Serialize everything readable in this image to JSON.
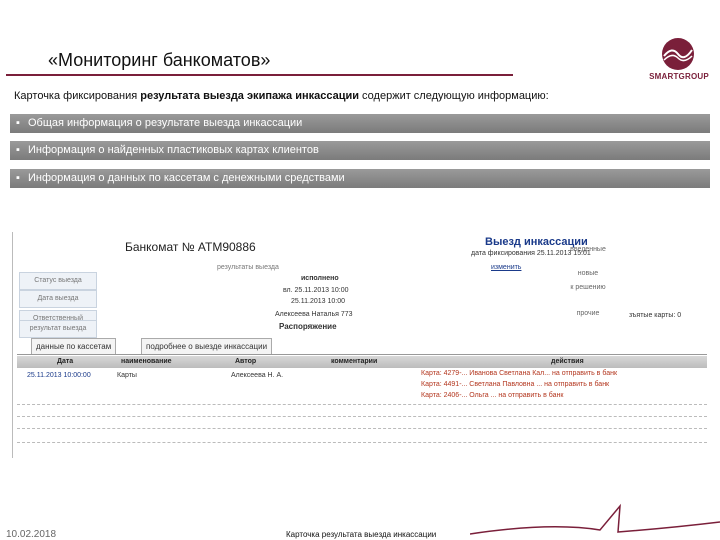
{
  "slide": {
    "title": "«Мониторинг банкоматов»",
    "intro_pre": "Карточка фиксирования ",
    "intro_bold": "результата выезда экипажа инкассации",
    "intro_post": " содержит следующую информацию:",
    "bars": [
      "Общая информация о результате выезда инкассации",
      "Информация о найденных пластиковых картах клиентов",
      "Информация о данных по кассетам с денежными средствами"
    ],
    "bullet": "▪",
    "logo_text": "SMARTGROUP",
    "footer_date": "10.02.2018",
    "footer_caption": "Карточка результата выезда инкассации",
    "accent_color": "#7a1f3a"
  },
  "screenshot": {
    "atm_title": "Банкомат № АТМ90886",
    "event_title": "Выезд инкассации",
    "event_date": "дата фиксирования 25.11.2013 15:01",
    "change_link": "изменить",
    "form": {
      "labels": [
        "Статус выезда",
        "Дата выезда",
        "Ответственный",
        "результат выезда"
      ],
      "status_header": "результаты выезда",
      "status_value": "исполнено",
      "date_value_1": "вл. 25.11.2013 10:00",
      "date_value_2": "25.11.2013 10:00",
      "responsible_value": "Алексеева Наталья 773",
      "result_value": "Распоряжение"
    },
    "right_labels": [
      "введенные",
      "новые",
      "к решению",
      "прочие"
    ],
    "right_tail": "зъятые карты: 0",
    "tabs": [
      "данные по кассетам",
      "подробнее о выезде инкассации"
    ],
    "table": {
      "headers": [
        "Дата",
        "наименование",
        "Автор",
        "комментарии",
        "действия"
      ],
      "row": {
        "date": "25.11.2013 10:00:00",
        "name": "Карты",
        "author": "Алексеева Н. А."
      },
      "actions": [
        "Карта: 4279-... Иванова Светлана Кал... на отправить в банк",
        "Карта: 4491-... Светлана Павловна ... на отправить в банк",
        "Карта: 2406-... Ольга ... на отправить в банк"
      ]
    }
  }
}
